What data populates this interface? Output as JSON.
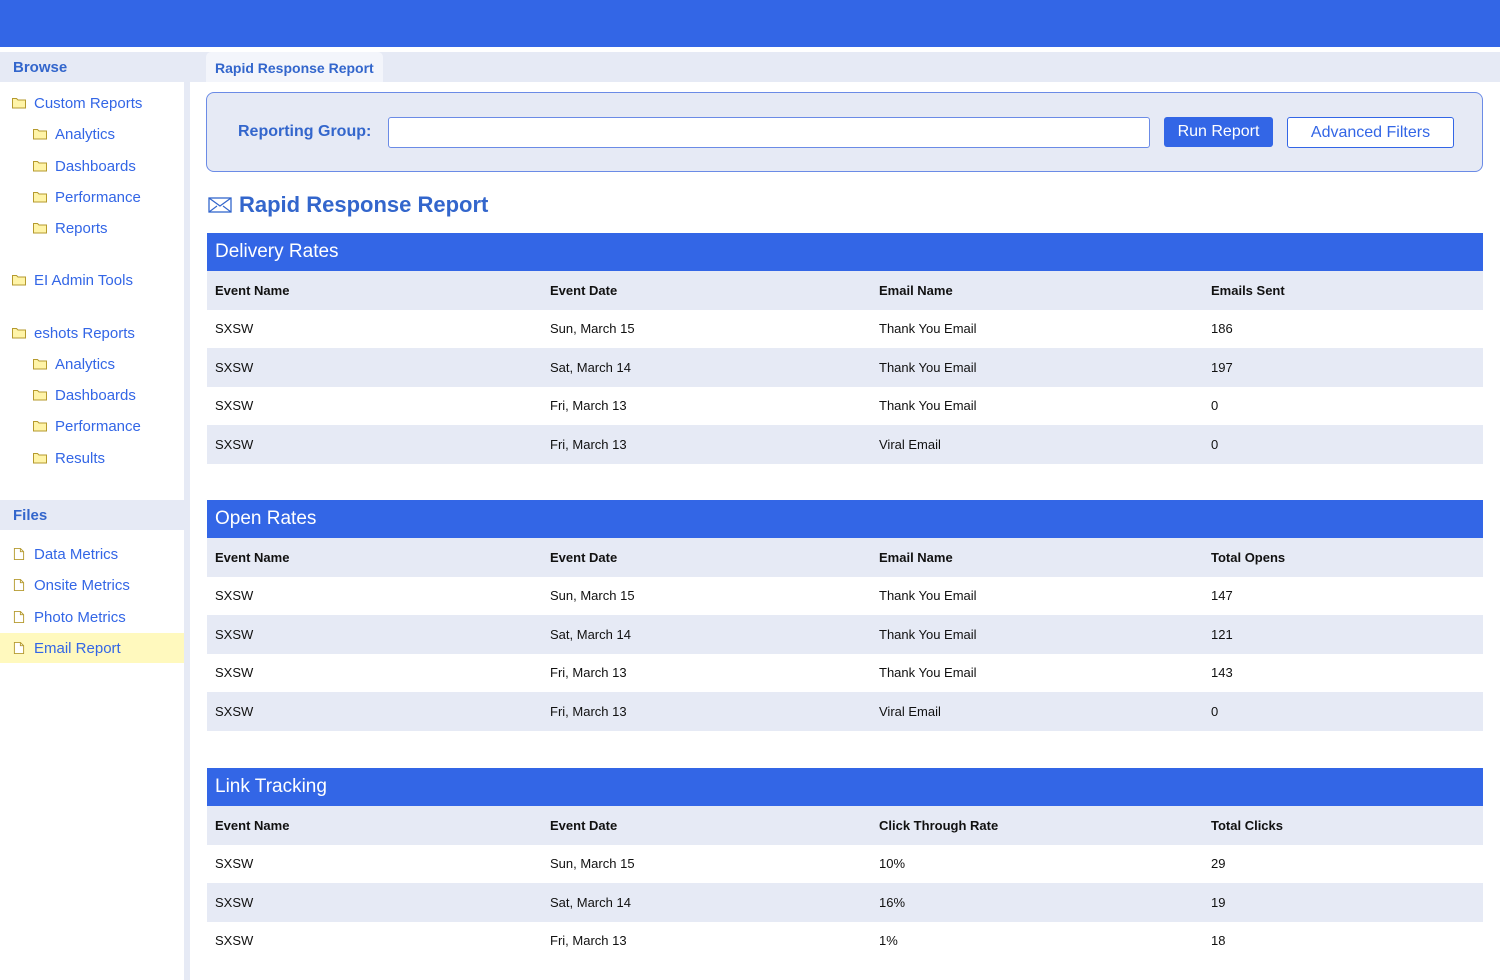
{
  "sidebar": {
    "browse_label": "Browse",
    "files_label": "Files",
    "browse_items": [
      {
        "label": "Custom Reports"
      },
      {
        "label": "Analytics"
      },
      {
        "label": "Dashboards"
      },
      {
        "label": "Performance"
      },
      {
        "label": "Reports"
      },
      {
        "label": "EI Admin Tools"
      },
      {
        "label": "eshots Reports"
      },
      {
        "label": "Analytics"
      },
      {
        "label": "Dashboards"
      },
      {
        "label": "Performance"
      },
      {
        "label": "Results"
      }
    ],
    "file_items": [
      {
        "label": "Data Metrics"
      },
      {
        "label": "Onsite Metrics"
      },
      {
        "label": "Photo Metrics"
      },
      {
        "label": "Email Report",
        "selected": true
      }
    ]
  },
  "tab": {
    "label": "Rapid Response Report"
  },
  "filter": {
    "label": "Reporting Group:",
    "value": "",
    "run_label": "Run Report",
    "advanced_label": "Advanced Filters"
  },
  "report": {
    "title": "Rapid Response Report",
    "icon": "envelope-icon"
  },
  "sections": [
    {
      "title": "Delivery Rates",
      "headers": [
        "Event Name",
        "Event Date",
        "Email Name",
        "Emails Sent"
      ],
      "rows": [
        [
          "SXSW",
          "Sun, March 15",
          "Thank You Email",
          "186"
        ],
        [
          "SXSW",
          "Sat, March 14",
          "Thank You Email",
          "197"
        ],
        [
          "SXSW",
          "Fri, March 13",
          "Thank You Email",
          "0"
        ],
        [
          "SXSW",
          "Fri, March 13",
          "Viral Email",
          "0"
        ]
      ]
    },
    {
      "title": "Open Rates",
      "headers": [
        "Event Name",
        "Event Date",
        "Email Name",
        "Total Opens"
      ],
      "rows": [
        [
          "SXSW",
          "Sun, March 15",
          "Thank You Email",
          "147"
        ],
        [
          "SXSW",
          "Sat, March 14",
          "Thank You Email",
          "121"
        ],
        [
          "SXSW",
          "Fri, March 13",
          "Thank You Email",
          "143"
        ],
        [
          "SXSW",
          "Fri, March 13",
          "Viral Email",
          "0"
        ]
      ]
    },
    {
      "title": "Link Tracking",
      "headers": [
        "Event Name",
        "Event Date",
        "Click Through Rate",
        "Total Clicks"
      ],
      "rows": [
        [
          "SXSW",
          "Sun, March 15",
          "10%",
          "29"
        ],
        [
          "SXSW",
          "Sat, March 14",
          "16%",
          "19"
        ],
        [
          "SXSW",
          "Fri, March 13",
          "1%",
          "18"
        ]
      ]
    }
  ],
  "colors": {
    "accent": "#3366e6",
    "panel": "#e6eaf5",
    "selected": "#fff9be"
  }
}
